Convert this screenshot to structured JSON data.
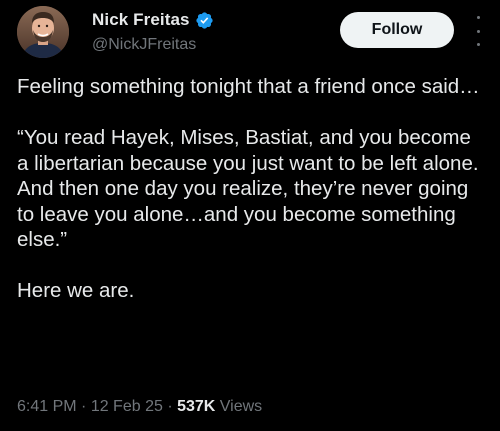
{
  "author": {
    "display_name": "Nick Freitas",
    "handle": "@NickJFreitas",
    "verified": true,
    "verified_color": "#1d9bf0"
  },
  "actions": {
    "follow_label": "Follow",
    "more_icon": "more-vertical-icon"
  },
  "tweet": {
    "paragraph_1": "Feeling something tonight that a friend once said…",
    "paragraph_2": "“You read Hayek, Mises, Bastiat, and you become a libertarian because you just want to be left alone. And then one day you realize, they’re never going to leave you alone…and you become something else.”",
    "paragraph_3": "Here we are."
  },
  "meta": {
    "time": "6:41 PM",
    "separator_1": " · ",
    "date": "12 Feb 25",
    "separator_2": " · ",
    "views_count": "537K",
    "views_label": " Views"
  },
  "colors": {
    "background": "#000000",
    "text": "#e7e9ea",
    "secondary": "#71767b",
    "button_bg": "#eff3f4",
    "button_text": "#0f1419"
  }
}
